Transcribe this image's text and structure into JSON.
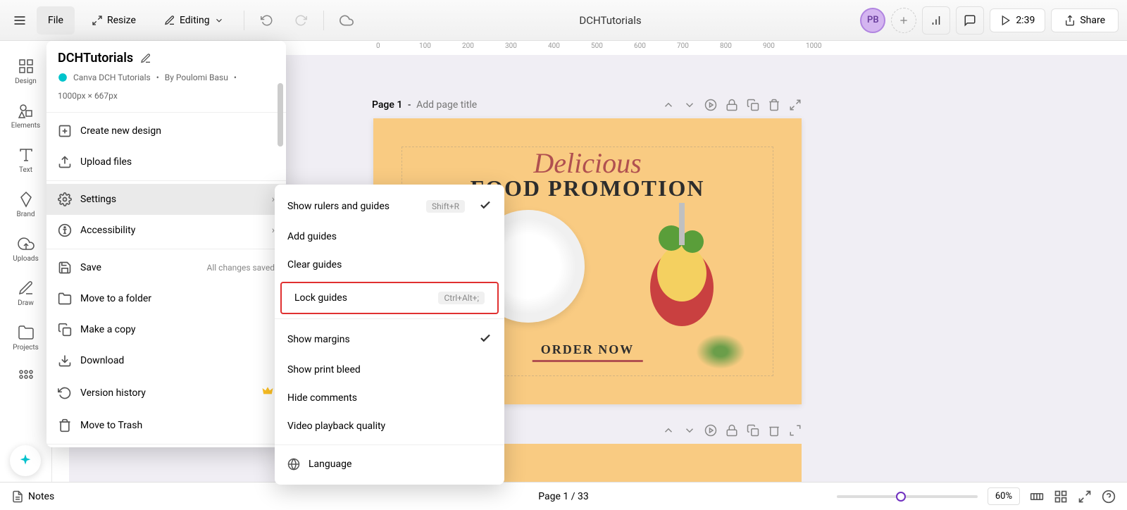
{
  "topbar": {
    "file_label": "File",
    "resize_label": "Resize",
    "editing_label": "Editing",
    "document_title": "DCHTutorials",
    "duration": "2:39",
    "share_label": "Share",
    "avatar_initials": "PB"
  },
  "sidebar": {
    "items": [
      {
        "label": "Design"
      },
      {
        "label": "Elements"
      },
      {
        "label": "Text"
      },
      {
        "label": "Brand"
      },
      {
        "label": "Uploads"
      },
      {
        "label": "Draw"
      },
      {
        "label": "Projects"
      }
    ]
  },
  "ruler_marks": [
    "0",
    "100",
    "200",
    "300",
    "400",
    "500",
    "600",
    "700",
    "800",
    "900",
    "1000"
  ],
  "page_header": {
    "label": "Page 1",
    "separator": "-",
    "placeholder": "Add page title"
  },
  "page_content": {
    "delicious": "Delicious",
    "food_promotion": "FOOD PROMOTION",
    "order_now": "ORDER NOW"
  },
  "file_menu": {
    "title": "DCHTutorials",
    "source": "Canva DCH Tutorials",
    "author": "By Poulomi Basu",
    "dims": "1000px × 667px",
    "items": {
      "create_new": "Create new design",
      "upload_files": "Upload files",
      "settings": "Settings",
      "accessibility": "Accessibility",
      "save": "Save",
      "saved_status": "All changes saved",
      "move_folder": "Move to a folder",
      "make_copy": "Make a copy",
      "download": "Download",
      "version_history": "Version history",
      "move_trash": "Move to Trash"
    }
  },
  "settings_menu": {
    "show_rulers": "Show rulers and guides",
    "show_rulers_shortcut": "Shift+R",
    "add_guides": "Add guides",
    "clear_guides": "Clear guides",
    "lock_guides": "Lock guides",
    "lock_guides_shortcut": "Ctrl+Alt+;",
    "show_margins": "Show margins",
    "show_print_bleed": "Show print bleed",
    "hide_comments": "Hide comments",
    "video_quality": "Video playback quality",
    "language": "Language"
  },
  "bottombar": {
    "notes": "Notes",
    "page_nav": "Page 1 / 33",
    "zoom": "60%"
  }
}
